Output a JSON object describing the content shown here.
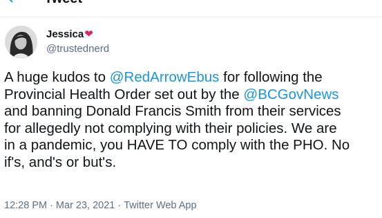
{
  "header": {
    "title": "Tweet",
    "back_icon": "arrow-left-icon"
  },
  "author": {
    "display_name": "Jessica",
    "name_emoji": "❤",
    "handle": "@trustednerd",
    "avatar_icon": "avatar-photo"
  },
  "tweet": {
    "lines": [
      {
        "parts": [
          {
            "text": "A huge kudos to ",
            "mention": false
          },
          {
            "text": "@RedArrowEbus",
            "mention": true
          },
          {
            "text": " for following the",
            "mention": false
          }
        ]
      },
      {
        "parts": [
          {
            "text": "Provincial Health Order set out by the ",
            "mention": false
          },
          {
            "text": "@BCGovNews",
            "mention": true
          }
        ]
      },
      {
        "parts": [
          {
            "text": "and banning Donald Francis Smith from their services",
            "mention": false
          }
        ]
      },
      {
        "parts": [
          {
            "text": "for allegedly not complying with their policies. We are",
            "mention": false
          }
        ]
      },
      {
        "parts": [
          {
            "text": "in a pandemic, you HAVE TO comply with the PHO. No",
            "mention": false
          }
        ]
      },
      {
        "parts": [
          {
            "text": "if's, and's or but's.",
            "mention": false
          }
        ]
      }
    ]
  },
  "meta": {
    "time": "12:28 PM",
    "separator": "·",
    "date": "Mar 23, 2021",
    "source": "Twitter Web App"
  },
  "colors": {
    "link": "#1b95e0",
    "secondary_text": "#5b7083",
    "heart": "#e0245e"
  }
}
